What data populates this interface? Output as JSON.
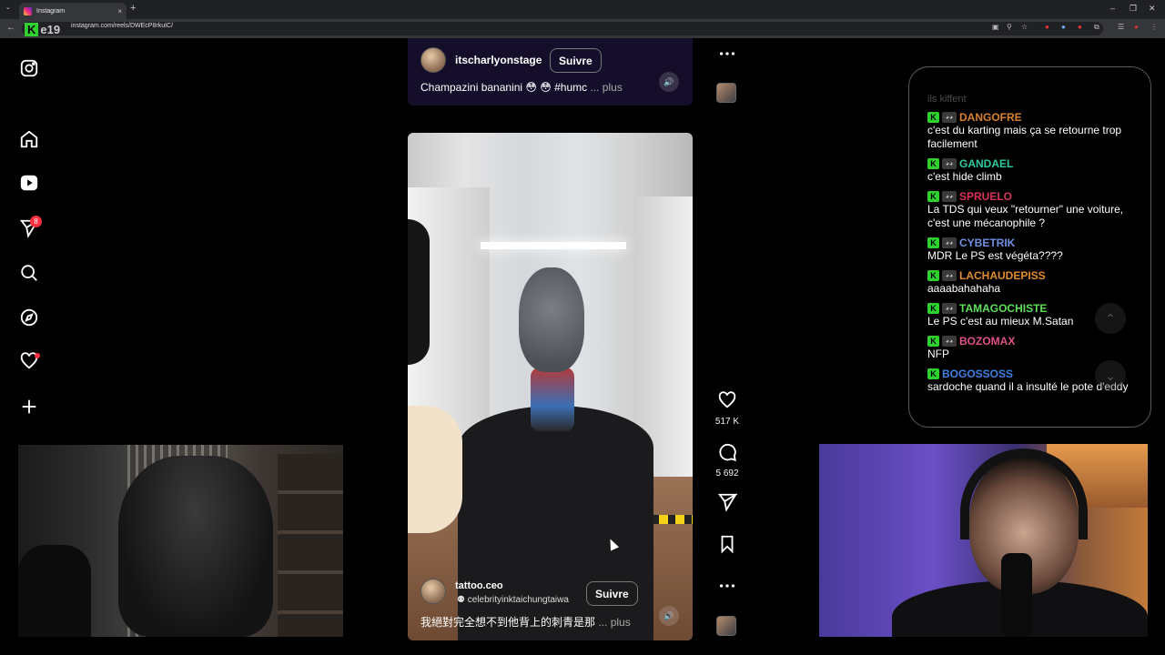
{
  "browser": {
    "tab_title": "Instagram",
    "url": "instagram.com/reels/DWEcP8rkuIC/",
    "new_tab": "+",
    "tab_close": "×",
    "back": "←",
    "logo_k": "K",
    "logo_text": "e19"
  },
  "sidebar": {
    "notification_count": "8"
  },
  "reel_top": {
    "username": "itscharlyonstage",
    "follow_label": "Suivre",
    "caption": "Champazini bananini 😳 😳 #humc",
    "more": "... plus"
  },
  "reel_main": {
    "username": "tattoo.ceo",
    "audio": "celebrityinktaichungtaiwa",
    "follow_label": "Suivre",
    "caption": "我絕對完全想不到他背上的刺青是那",
    "more": "... plus"
  },
  "actions": {
    "likes": "517 K",
    "comments": "5 692"
  },
  "chat": {
    "faded_line": "ils kiffent",
    "messages": [
      {
        "user": "DANGOFRE",
        "color": "#d9822b",
        "text": "c'est du karting mais ça se retourne trop facilement"
      },
      {
        "user": "GANDAEL",
        "color": "#2fc9a0",
        "text": "c'est hide climb"
      },
      {
        "user": "SPRUELO",
        "color": "#d8325a",
        "text": "La TDS qui veux \"retourner\" une voiture, c'est une mécanophile ?"
      },
      {
        "user": "CYBETRIK",
        "color": "#6f8fe0",
        "text": "MDR Le PS est végéta????"
      },
      {
        "user": "LACHAUDEPISS",
        "color": "#e08a2b",
        "text": "aaaabahahaha"
      },
      {
        "user": "TAMAGOCHISTE",
        "color": "#5ee05a",
        "text": "Le PS c'est au mieux M.Satan"
      },
      {
        "user": "BOZOMAX",
        "color": "#e0508a",
        "text": "NFP"
      },
      {
        "user": "BOGOSSOSS",
        "color": "#3f7fe0",
        "text": "sardoche quand il a insulté le pote d'eddy"
      }
    ]
  },
  "colors": {
    "notification": "#ff3040",
    "kick_green": "#2fd12f",
    "reel_top_bg": "#150e2a"
  }
}
